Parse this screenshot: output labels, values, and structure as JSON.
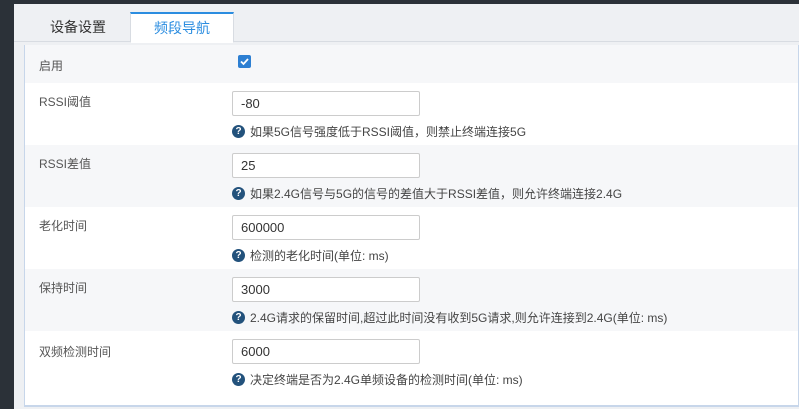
{
  "tabs": [
    {
      "label": "设备设置"
    },
    {
      "label": "频段导航"
    }
  ],
  "form": {
    "enable": {
      "label": "启用",
      "checked": true
    },
    "rssi_threshold": {
      "label": "RSSI阈值",
      "value": "-80",
      "help": "如果5G信号强度低于RSSI阈值，则禁止终端连接5G"
    },
    "rssi_diff": {
      "label": "RSSI差值",
      "value": "25",
      "help": "如果2.4G信号与5G的信号的差值大于RSSI差值，则允许终端连接2.4G"
    },
    "aging_time": {
      "label": "老化时间",
      "value": "600000",
      "help": "检测的老化时间(单位: ms)"
    },
    "hold_time": {
      "label": "保持时间",
      "value": "3000",
      "help": "2.4G请求的保留时间,超过此时间没有收到5G请求,则允许连接到2.4G(单位: ms)"
    },
    "dual_band_detect_time": {
      "label": "双频检测时间",
      "value": "6000",
      "help": "决定终端是否为2.4G单频设备的检测时间(单位: ms)"
    }
  },
  "icons": {
    "help": "question-circle-icon",
    "check": "check-icon"
  },
  "colors": {
    "accent": "#2b8de0",
    "checkbox": "#2d7fd2",
    "help_icon": "#23527c",
    "background_dark": "#2b3138"
  }
}
